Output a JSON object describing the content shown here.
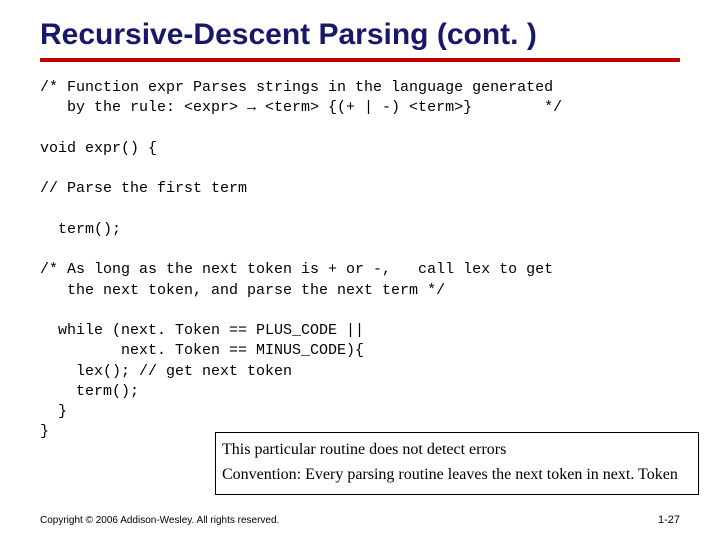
{
  "title": "Recursive-Descent Parsing (cont. )",
  "code_lines": {
    "c1": "/* Function expr Parses strings in the language generated",
    "c2": "   by the rule: <expr> → <term> {(+ | -) <term>}        */",
    "blank1": "",
    "c3": "void expr() {",
    "blank2": "",
    "c4": "// Parse the first term",
    "blank3": "",
    "c5": "  term();",
    "blank4": "",
    "c6": "/* As long as the next token is + or -,   call lex to get",
    "c7": "   the next token, and parse the next term */",
    "blank5": "",
    "c8": "  while (next. Token == PLUS_CODE ||",
    "c9": "         next. Token == MINUS_CODE){",
    "c10": "    lex(); // get next token",
    "c11": "    term();",
    "c12": "  }",
    "c13": "}"
  },
  "callout": {
    "line1": "This particular routine does not detect errors",
    "line2": "Convention: Every parsing routine leaves the next token in next. Token"
  },
  "footer": "Copyright © 2006 Addison-Wesley. All rights reserved.",
  "pagenum": "1-27"
}
